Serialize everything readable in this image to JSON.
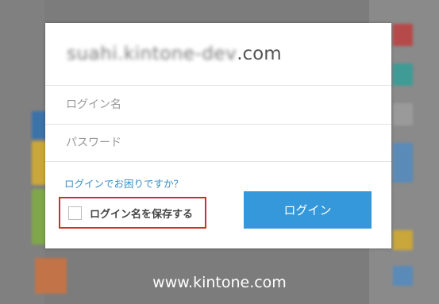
{
  "login": {
    "domain_blurred": "suahi.kintone-dev",
    "domain_suffix": ".com",
    "username_placeholder": "ログイン名",
    "password_placeholder": "パスワード",
    "help_link": "ログインでお困りですか？",
    "remember_label": "ログイン名を保存する",
    "remember_checked": false,
    "login_button": "ログイン"
  },
  "footer": {
    "url": "www.kintone.com"
  },
  "colors": {
    "accent": "#3498db",
    "link": "#3a8fc8",
    "highlight_border": "#d52b2b",
    "overlay": "#7c7c7c"
  }
}
